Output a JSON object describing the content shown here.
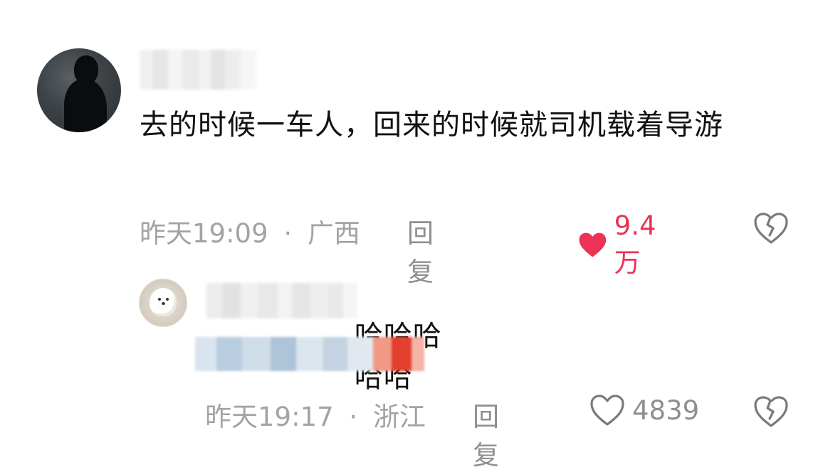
{
  "comments": [
    {
      "avatar_icon": "dark-silhouette-avatar",
      "text": "去的时候一车人，回来的时候就司机载着导游",
      "time": "昨天19:09",
      "location": "广西",
      "separator": "·",
      "reply_label": "回复",
      "like_icon": "heart-filled-icon",
      "likes": "9.4万",
      "liked": true,
      "like_color": "#ec3255",
      "dislike_icon": "broken-heart-icon"
    },
    {
      "avatar_icon": "white-puppy-avatar",
      "text": "哈哈哈哈哈",
      "time": "昨天19:17",
      "location": "浙江",
      "separator": "·",
      "reply_label": "回复",
      "like_icon": "heart-outline-icon",
      "likes": "4839",
      "liked": false,
      "dislike_icon": "broken-heart-icon"
    }
  ],
  "colors": {
    "meta_gray": "#a3a3a3",
    "text_dark": "#111111",
    "like_active": "#ec3255"
  }
}
